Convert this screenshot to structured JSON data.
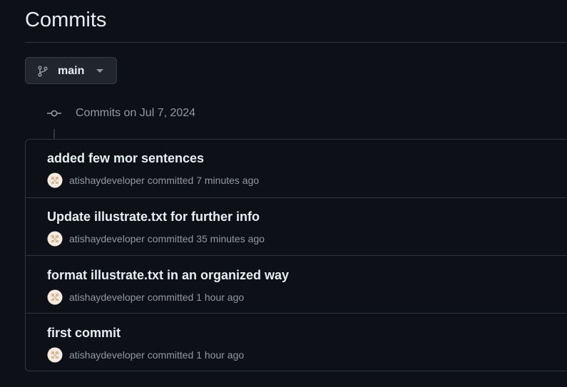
{
  "page": {
    "title": "Commits"
  },
  "branch": {
    "name": "main",
    "icon": "git-branch-icon"
  },
  "group": {
    "heading": "Commits on Jul 7, 2024",
    "icon": "git-commit-icon"
  },
  "commits": [
    {
      "title": "added few mor sentences",
      "author": "atishaydeveloper",
      "verb": "committed",
      "time": "7 minutes ago"
    },
    {
      "title": "Update illustrate.txt for further info",
      "author": "atishaydeveloper",
      "verb": "committed",
      "time": "35 minutes ago"
    },
    {
      "title": "format illustrate.txt in an organized way",
      "author": "atishaydeveloper",
      "verb": "committed",
      "time": "1 hour ago"
    },
    {
      "title": "first commit",
      "author": "atishaydeveloper",
      "verb": "committed",
      "time": "1 hour ago"
    }
  ],
  "colors": {
    "background": "#0d1117",
    "border": "#30363d",
    "text_primary": "#e6edf3",
    "text_muted": "#9198a1",
    "button_bg": "#21262d"
  }
}
